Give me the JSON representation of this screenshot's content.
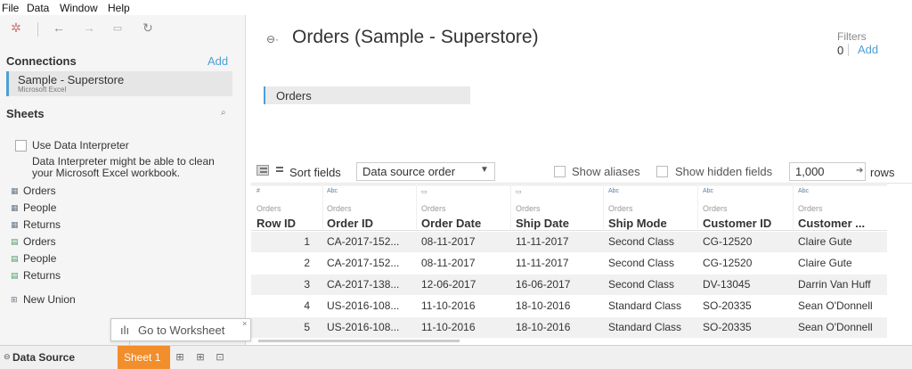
{
  "menu": [
    "File",
    "Data",
    "Window",
    "Help"
  ],
  "toolbar": {
    "icons": [
      "tableau-logo-icon",
      "back-icon",
      "forward-icon",
      "save-icon",
      "refresh-icon"
    ]
  },
  "connections": {
    "title": "Connections",
    "add_label": "Add",
    "items": [
      {
        "name": "Sample - Superstore",
        "type": "Microsoft Excel"
      }
    ]
  },
  "sheets": {
    "title": "Sheets",
    "interpreter_label": "Use Data Interpreter",
    "interpreter_text": "Data Interpreter might be able to clean your Microsoft Excel workbook.",
    "items": [
      {
        "label": "Orders",
        "kind": "sheet"
      },
      {
        "label": "People",
        "kind": "sheet"
      },
      {
        "label": "Returns",
        "kind": "sheet"
      },
      {
        "label": "Orders",
        "kind": "named-range"
      },
      {
        "label": "People",
        "kind": "named-range"
      },
      {
        "label": "Returns",
        "kind": "named-range"
      }
    ],
    "new_union_label": "New Union"
  },
  "main": {
    "title": "Orders (Sample - Superstore)",
    "filters_label": "Filters",
    "filters_count": "0",
    "filters_add": "Add",
    "canvas_table": "Orders"
  },
  "grid_toolbar": {
    "sort_label": "Sort fields",
    "sort_value": "Data source order",
    "show_aliases": "Show aliases",
    "show_hidden": "Show hidden fields",
    "rows_value": "1,000",
    "rows_label": "rows"
  },
  "grid": {
    "columns": [
      {
        "type": "#",
        "source": "Orders",
        "name": "Row ID"
      },
      {
        "type": "Abc",
        "source": "Orders",
        "name": "Order ID"
      },
      {
        "type": "date",
        "source": "Orders",
        "name": "Order Date"
      },
      {
        "type": "date",
        "source": "Orders",
        "name": "Ship Date"
      },
      {
        "type": "Abc",
        "source": "Orders",
        "name": "Ship Mode"
      },
      {
        "type": "Abc",
        "source": "Orders",
        "name": "Customer ID"
      },
      {
        "type": "Abc",
        "source": "Orders",
        "name": "Customer ..."
      }
    ],
    "rows": [
      [
        "1",
        "CA-2017-152...",
        "08-11-2017",
        "11-11-2017",
        "Second Class",
        "CG-12520",
        "Claire Gute"
      ],
      [
        "2",
        "CA-2017-152...",
        "08-11-2017",
        "11-11-2017",
        "Second Class",
        "CG-12520",
        "Claire Gute"
      ],
      [
        "3",
        "CA-2017-138...",
        "12-06-2017",
        "16-06-2017",
        "Second Class",
        "DV-13045",
        "Darrin Van Huff"
      ],
      [
        "4",
        "US-2016-108...",
        "11-10-2016",
        "18-10-2016",
        "Standard Class",
        "SO-20335",
        "Sean O'Donnell"
      ],
      [
        "5",
        "US-2016-108...",
        "11-10-2016",
        "18-10-2016",
        "Standard Class",
        "SO-20335",
        "Sean O'Donnell"
      ]
    ]
  },
  "tooltip": {
    "text": "Go to Worksheet",
    "close": "×"
  },
  "tabs": {
    "data_source": "Data Source",
    "sheet": "Sheet 1",
    "new_tab_icons": [
      "new-worksheet-icon",
      "new-dashboard-icon",
      "new-story-icon"
    ]
  },
  "colors": {
    "accent": "#4f9fd4",
    "sheet_tab": "#f28e2b",
    "panel_bg": "#f5f5f5",
    "row_shade": "#f1f1f1"
  }
}
